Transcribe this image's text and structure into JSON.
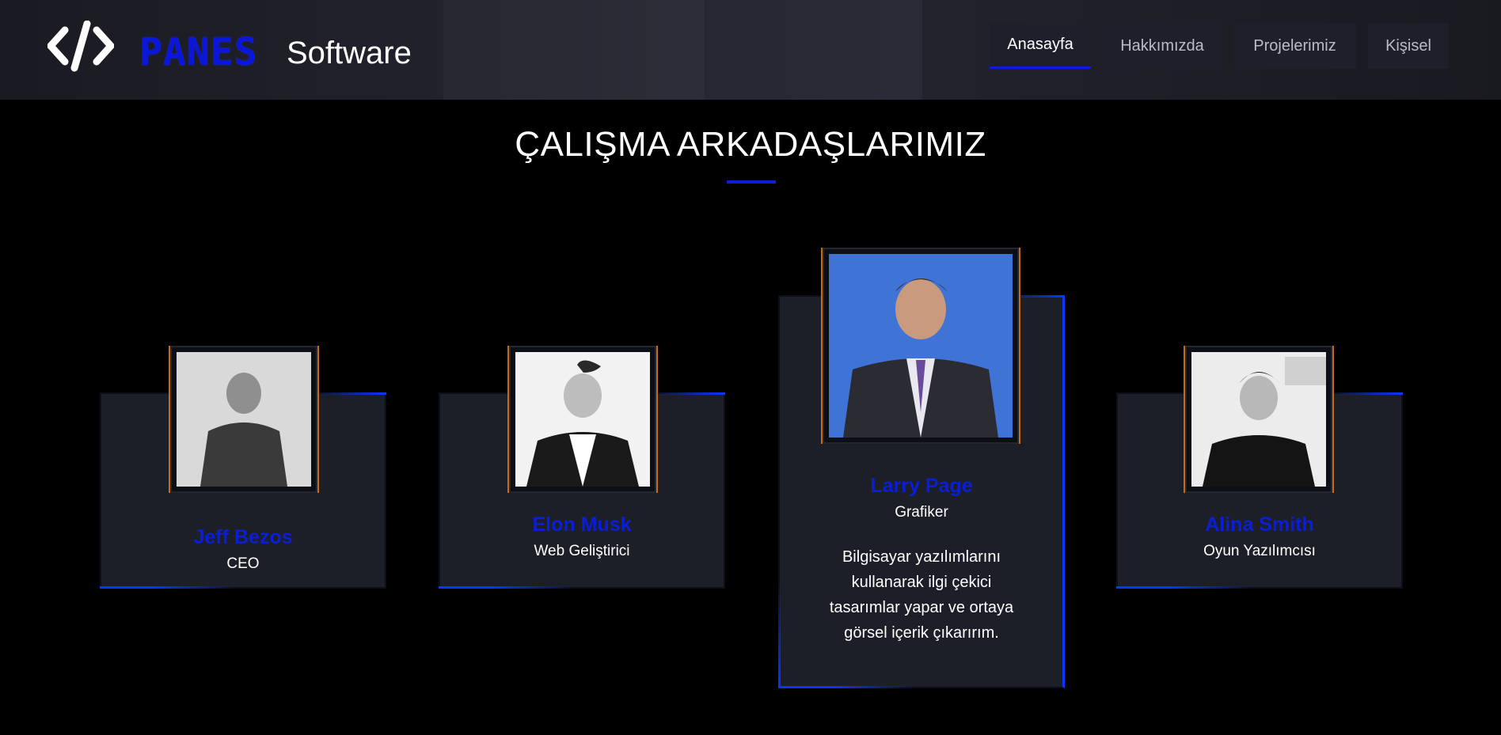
{
  "header": {
    "brand": "PANES",
    "brand_sub": "Software",
    "nav": [
      {
        "label": "Anasayfa",
        "active": true
      },
      {
        "label": "Hakkımızda",
        "active": false
      },
      {
        "label": "Projelerimiz",
        "active": false
      },
      {
        "label": "Kişisel",
        "active": false
      }
    ]
  },
  "section": {
    "title": "ÇALIŞMA ARKADAŞLARIMIZ"
  },
  "team": [
    {
      "name": "Jeff Bezos",
      "role": "CEO",
      "photo": "photo-icon"
    },
    {
      "name": "Elon Musk",
      "role": "Web Geliştirici",
      "photo": "photo-icon"
    },
    {
      "name": "Larry Page",
      "role": "Grafiker",
      "bio": "Bilgisayar yazılımlarını kullanarak ilgi çekici tasarımlar yapar ve ortaya görsel içerik çıkarırım.",
      "photo": "photo-icon"
    },
    {
      "name": "Alina Smith",
      "role": "Oyun Yazılımcısı",
      "photo": "photo-icon"
    }
  ],
  "colors": {
    "accent": "#0a1ed8",
    "card_bg": "#1c1f28",
    "frame_glow": "#c76a10"
  }
}
